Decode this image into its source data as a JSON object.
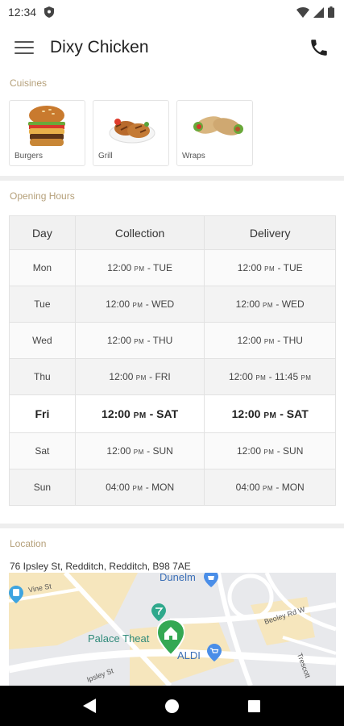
{
  "status_bar": {
    "time": "12:34"
  },
  "app_bar": {
    "title": "Dixy Chicken"
  },
  "cuisines": {
    "label": "Cuisines",
    "items": [
      {
        "label": "Burgers"
      },
      {
        "label": "Grill"
      },
      {
        "label": "Wraps"
      }
    ]
  },
  "opening_hours": {
    "label": "Opening Hours",
    "headers": {
      "day": "Day",
      "collection": "Collection",
      "delivery": "Delivery"
    },
    "rows": [
      {
        "day": "Mon",
        "col_start": "12:00",
        "col_ampm": "PM",
        "col_end": "- TUE",
        "del_start": "12:00",
        "del_ampm": "PM",
        "del_end": "- TUE"
      },
      {
        "day": "Tue",
        "col_start": "12:00",
        "col_ampm": "PM",
        "col_end": "- WED",
        "del_start": "12:00",
        "del_ampm": "PM",
        "del_end": "- WED"
      },
      {
        "day": "Wed",
        "col_start": "12:00",
        "col_ampm": "PM",
        "col_end": "- THU",
        "del_start": "12:00",
        "del_ampm": "PM",
        "del_end": "- THU"
      },
      {
        "day": "Thu",
        "col_start": "12:00",
        "col_ampm": "PM",
        "col_end": "- FRI",
        "del_start": "12:00",
        "del_ampm": "PM",
        "del_end": "- 11:45",
        "del_end_ampm": "PM"
      },
      {
        "day": "Fri",
        "col_start": "12:00",
        "col_ampm": "PM",
        "col_end": "- SAT",
        "del_start": "12:00",
        "del_ampm": "PM",
        "del_end": "- SAT"
      },
      {
        "day": "Sat",
        "col_start": "12:00",
        "col_ampm": "PM",
        "col_end": "- SUN",
        "del_start": "12:00",
        "del_ampm": "PM",
        "del_end": "- SUN"
      },
      {
        "day": "Sun",
        "col_start": "04:00",
        "col_ampm": "PM",
        "col_end": "- MON",
        "del_start": "04:00",
        "del_ampm": "PM",
        "del_end": "- MON"
      }
    ]
  },
  "location": {
    "label": "Location",
    "address": "76 Ipsley St, Redditch, Redditch, B98 7AE",
    "map_labels": {
      "dunelm": "Dunelm",
      "palace": "Palace Theat",
      "aldi": "ALDI",
      "vine": "Vine St",
      "beoley": "Beoley Rd W",
      "ipsley": "Ipsley St",
      "trescott": "Trescott"
    }
  },
  "colors": {
    "accent_label": "#b5a07a",
    "map_pin": "#34a853",
    "poi_blue": "#4a8ee8"
  }
}
